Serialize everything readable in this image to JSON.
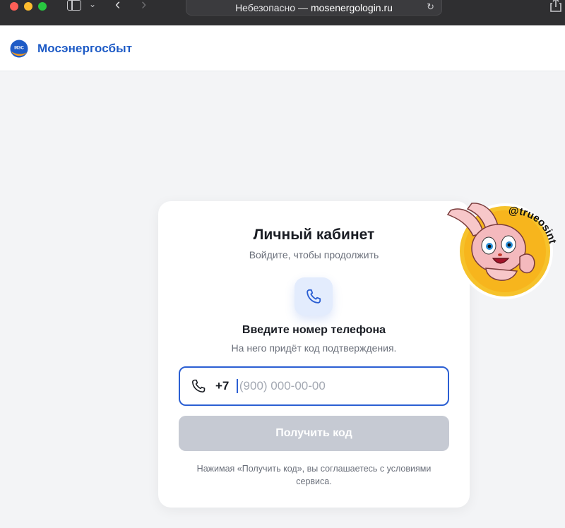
{
  "browser": {
    "url_prefix": "Небезопасно —",
    "url_domain": "mosenergologin.ru"
  },
  "header": {
    "logo_text": "МЭС",
    "brand": "Мосэнергосбыт",
    "brand_color": "#1e5bc6"
  },
  "card": {
    "title": "Личный кабинет",
    "subtitle": "Войдите, чтобы продолжить",
    "step_title": "Введите номер телефона",
    "step_subtitle": "На него придёт код подтверждения.",
    "phone_prefix": "+7",
    "phone_placeholder": "(900) 000-00-00",
    "phone_value": "",
    "submit_label": "Получить код",
    "terms": "Нажимая «Получить код», вы соглашаетесь с условиями сервиса.",
    "accent_color": "#2b5fd3"
  },
  "sticker": {
    "text": "@trueosint",
    "icon": "bunny-sticker"
  }
}
